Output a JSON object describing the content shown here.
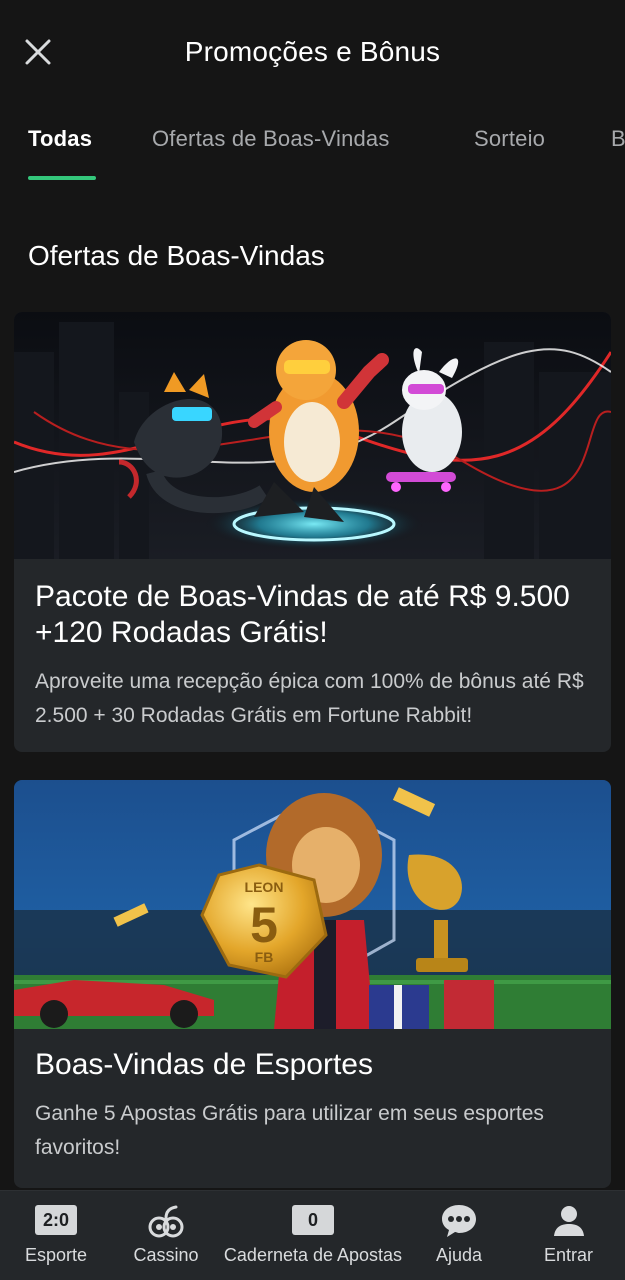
{
  "header": {
    "title": "Promoções e Bônus",
    "close_icon": "close-icon"
  },
  "tabs": [
    {
      "label": "Todas",
      "active": true
    },
    {
      "label": "Ofertas de Boas-Vindas",
      "active": false
    },
    {
      "label": "Sorteio",
      "active": false
    },
    {
      "label": "B",
      "active": false
    }
  ],
  "section": {
    "title": "Ofertas de Boas-Vindas"
  },
  "promotions": [
    {
      "title": "Pacote de Boas-Vindas de até R$ 9.500 +120 Rodadas Grátis!",
      "description": "Aproveite uma recepção épica com 100% de bônus até R$ 2.500 + 30 Rodadas Grátis em Fortune Rabbit!"
    },
    {
      "title": "Boas-Vindas de Esportes",
      "description": "Ganhe 5 Apostas Grátis para utilizar em seus esportes favoritos!",
      "coin_text": {
        "brand": "LEON",
        "value": "5",
        "unit": "FB"
      }
    }
  ],
  "bottom_nav": [
    {
      "label": "Esporte",
      "icon": "score-icon",
      "badge": "2:0"
    },
    {
      "label": "Cassino",
      "icon": "casino-icon"
    },
    {
      "label": "Caderneta de Apostas",
      "icon": "betslip-icon",
      "badge": "0"
    },
    {
      "label": "Ajuda",
      "icon": "chat-help-icon"
    },
    {
      "label": "Entrar",
      "icon": "user-icon"
    }
  ],
  "colors": {
    "background": "#151515",
    "card": "#24272a",
    "accent": "#34c77b",
    "text_muted": "#a7a9ac"
  }
}
